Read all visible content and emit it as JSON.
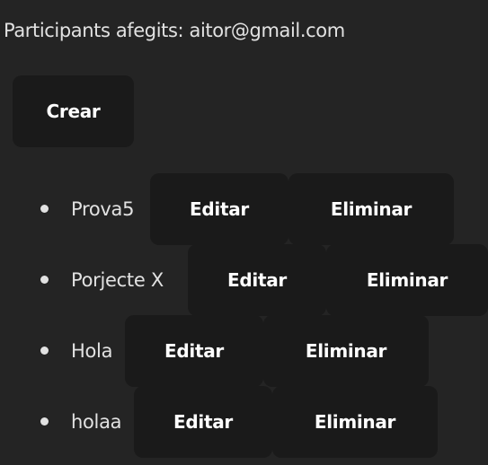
{
  "participants": {
    "text": "Participants afegits: aitor@gmail.com"
  },
  "create_button": {
    "label": "Crear"
  },
  "projects": [
    {
      "name": "Prova5",
      "edit_label": "Editar",
      "delete_label": "Eliminar"
    },
    {
      "name": "Porjecte X",
      "edit_label": "Editar",
      "delete_label": "Eliminar"
    },
    {
      "name": "Hola",
      "edit_label": "Editar",
      "delete_label": "Eliminar"
    },
    {
      "name": "holaa",
      "edit_label": "Editar",
      "delete_label": "Eliminar"
    }
  ],
  "colors": {
    "background": "#242424",
    "button_background": "#1a1a1a",
    "text": "#dedede"
  }
}
